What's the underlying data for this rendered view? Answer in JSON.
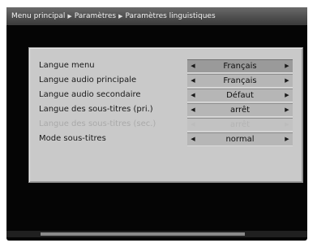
{
  "breadcrumb": {
    "items": [
      "Menu principal",
      "Paramètres",
      "Paramètres linguistiques"
    ],
    "separator": "▶"
  },
  "settings": {
    "rows": [
      {
        "label": "Langue menu",
        "value": "Français",
        "state": "selected"
      },
      {
        "label": "Langue audio principale",
        "value": "Français",
        "state": "normal"
      },
      {
        "label": "Langue audio secondaire",
        "value": "Défaut",
        "state": "normal"
      },
      {
        "label": "Langue des sous-titres (pri.)",
        "value": "arrêt",
        "state": "normal"
      },
      {
        "label": "Langue des sous-titres (sec.)",
        "value": "arrêt",
        "state": "disabled"
      },
      {
        "label": "Mode sous-titres",
        "value": "normal",
        "state": "normal"
      }
    ],
    "arrow_left": "◀",
    "arrow_right": "▶"
  },
  "colors": {
    "screen_bg": "#050505",
    "panel_bg": "#c9c9c9",
    "breadcrumb_bg": "#4c4c4c"
  }
}
